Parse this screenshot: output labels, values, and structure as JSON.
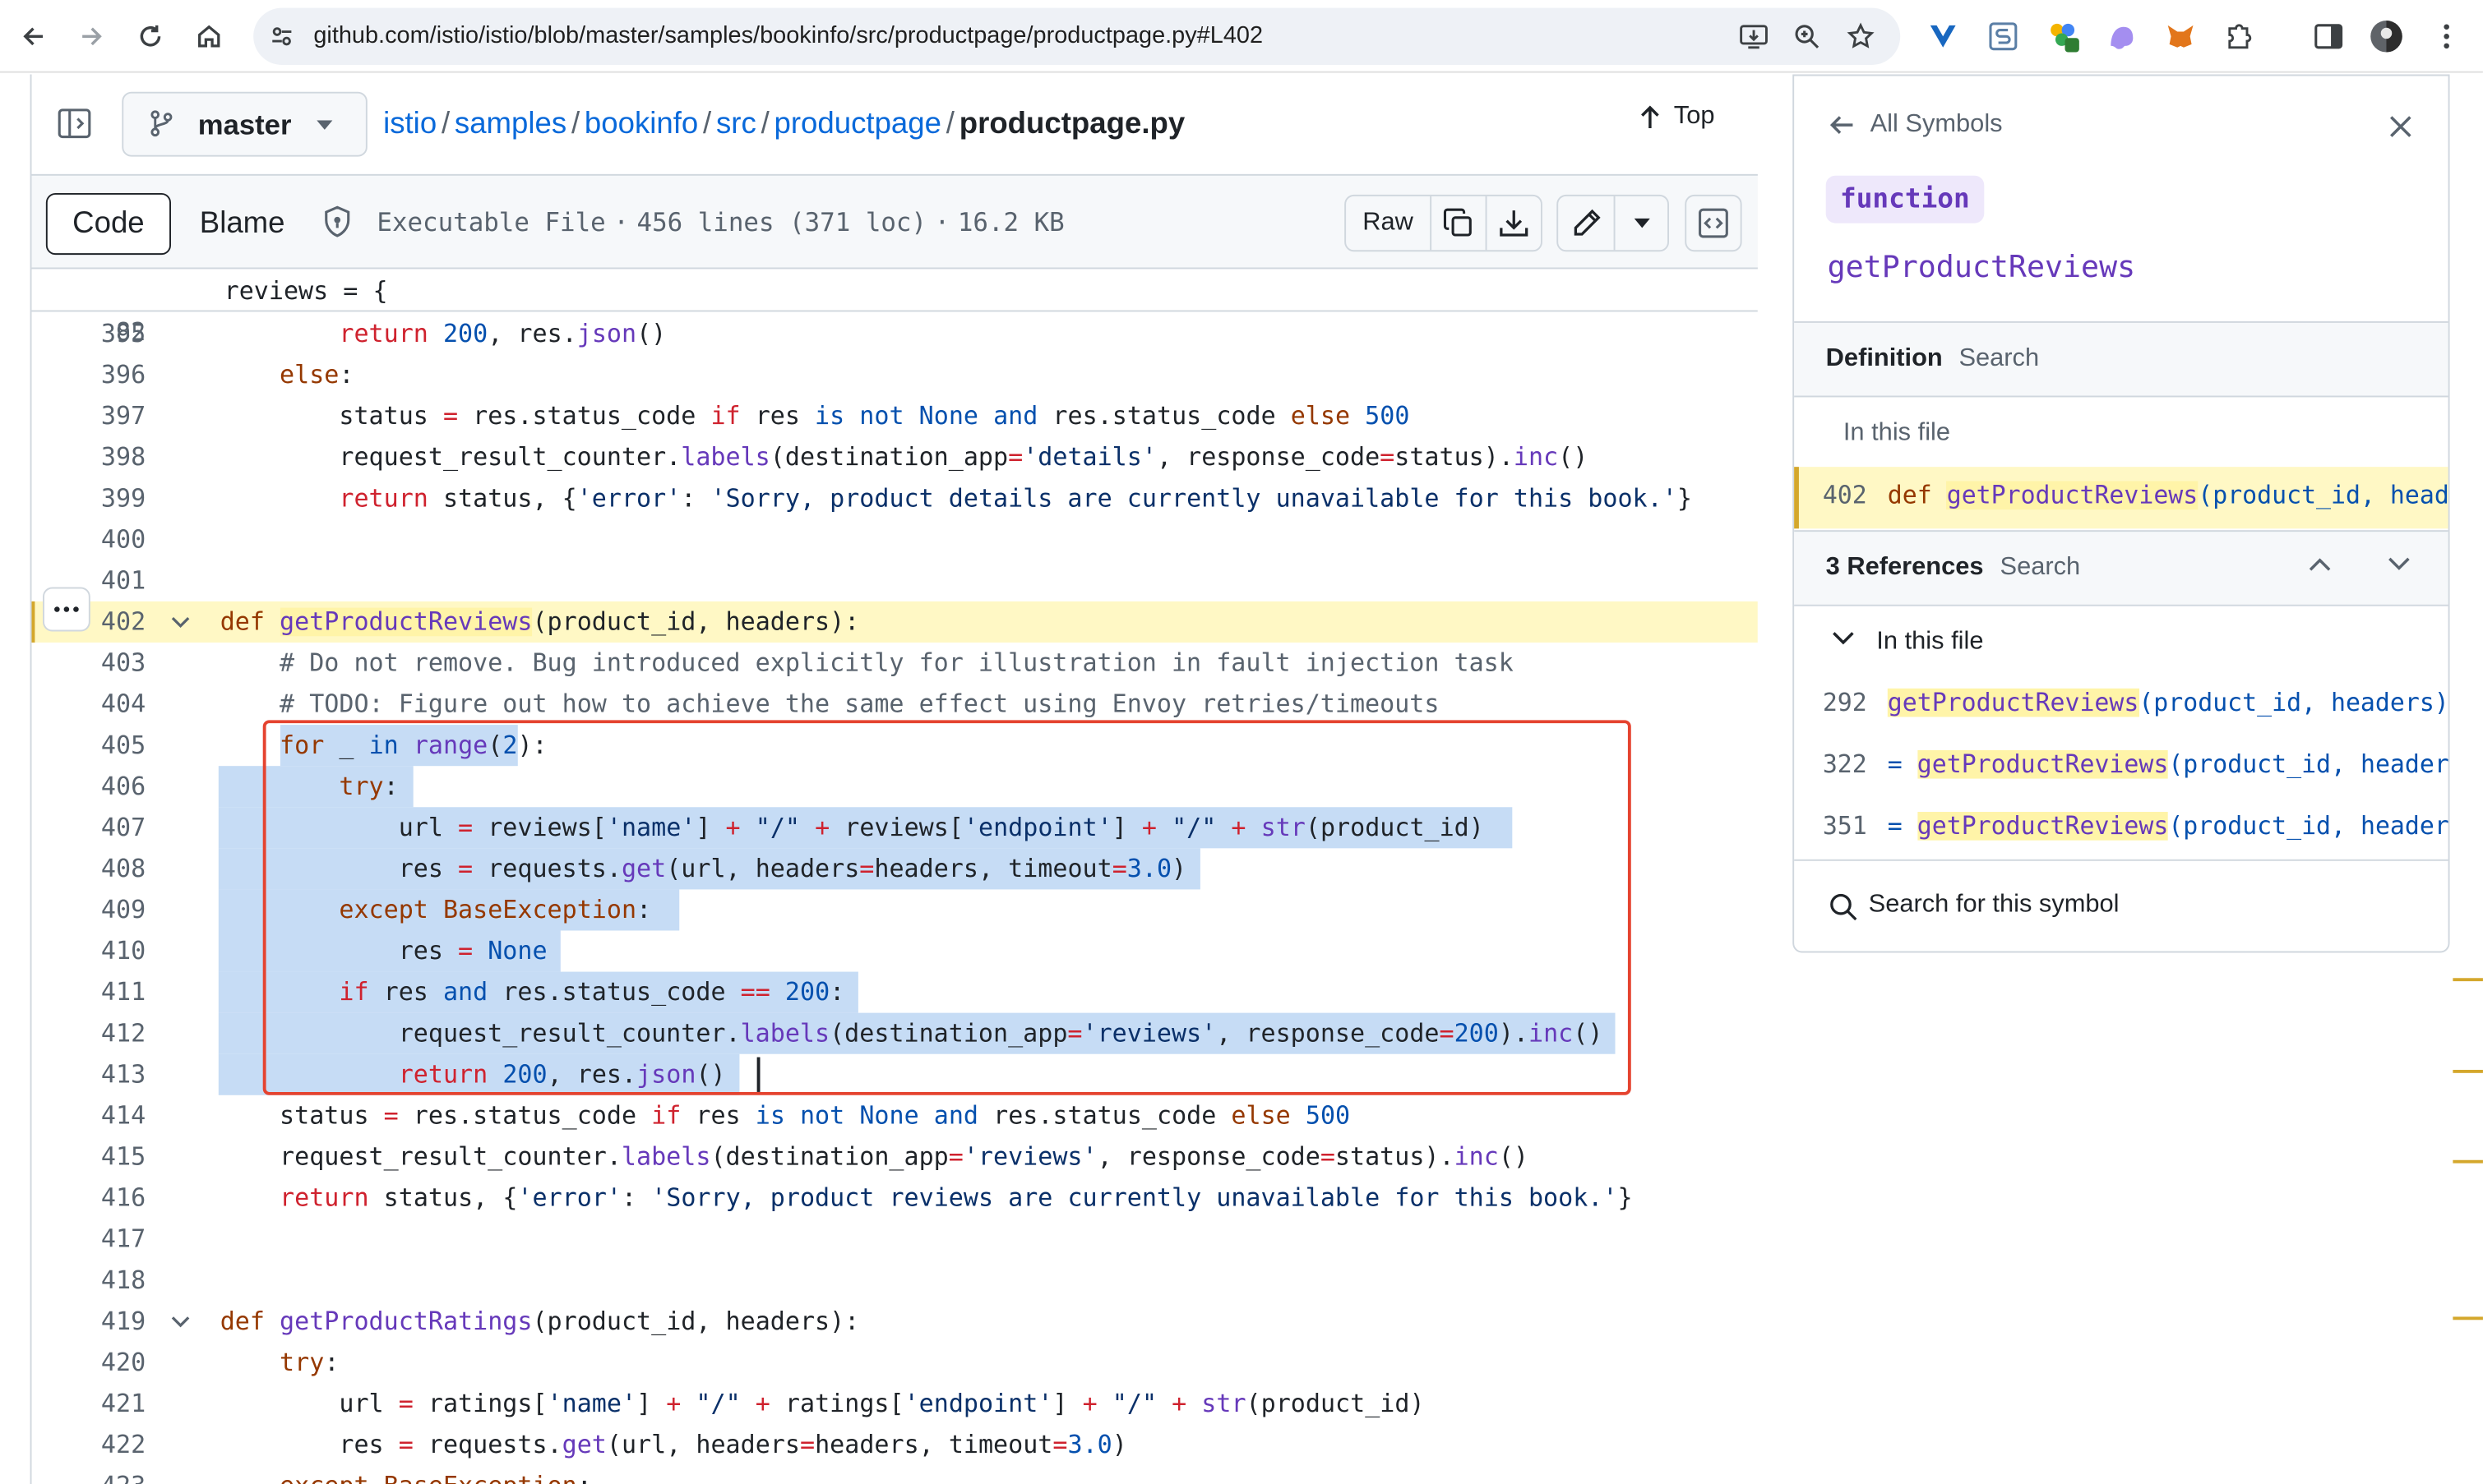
{
  "browser": {
    "url": "github.com/istio/istio/blob/master/samples/bookinfo/src/productpage/productpage.py#L402"
  },
  "file_header": {
    "branch": "master",
    "breadcrumbs": [
      "istio",
      "samples",
      "bookinfo",
      "src",
      "productpage"
    ],
    "separator": "/",
    "filename": "productpage.py",
    "top_label": "Top"
  },
  "toolbar": {
    "code_tab": "Code",
    "blame_tab": "Blame",
    "file_type": "Executable File",
    "dot": "·",
    "lines_info": "456 lines (371 loc)",
    "size": "16.2 KB",
    "raw_label": "Raw"
  },
  "code": {
    "sticky": {
      "n": "82",
      "text": "    reviews = {"
    },
    "lines": [
      {
        "n": "395",
        "html": "        <span class=\"kw\">return</span> <span class=\"num\">200</span>, res.<span class=\"fn\">json</span>()"
      },
      {
        "n": "396",
        "html": "    <span class=\"kw2\">else</span>:"
      },
      {
        "n": "397",
        "html": "        status <span class=\"kw\">=</span> res.status_code <span class=\"kw\">if</span> res <span class=\"num\">is not</span> <span class=\"num\">None</span> <span class=\"num\">and</span> res.status_code <span class=\"kw2\">else</span> <span class=\"num\">500</span>"
      },
      {
        "n": "398",
        "html": "        request_result_counter.<span class=\"fn\">labels</span>(destination_app<span class=\"kw\">=</span><span class=\"str\">'details'</span>, response_code<span class=\"kw\">=</span>status).<span class=\"fn\">inc</span>()"
      },
      {
        "n": "399",
        "html": "        <span class=\"kw\">return</span> status, {<span class=\"str\">'error'</span>: <span class=\"str\">'Sorry, product details are currently unavailable for this book.'</span>}"
      },
      {
        "n": "400",
        "html": ""
      },
      {
        "n": "401",
        "html": ""
      },
      {
        "n": "402",
        "html": "<span class=\"kw2\">def</span> <span class=\"fn mark\">getProductReviews</span>(product_id, headers):",
        "highlight": true,
        "fold": true
      },
      {
        "n": "403",
        "html": "    <span class=\"cm\"># Do not remove. Bug introduced explicitly for illustration in fault injection task</span>"
      },
      {
        "n": "404",
        "html": "    <span class=\"cm\"># TODO: Figure out how to achieve the same effect using Envoy retries/timeouts</span>"
      },
      {
        "n": "405",
        "html": "    <span class=\"kw2\">for</span> _ <span class=\"num\">in</span> <span class=\"fn\">range</span>(<span class=\"num\">2</span>):"
      },
      {
        "n": "406",
        "html": "        <span class=\"kw2\">try</span>:"
      },
      {
        "n": "407",
        "html": "            url <span class=\"kw\">=</span> reviews[<span class=\"str\">'name'</span>] <span class=\"kw\">+</span> <span class=\"str\">\"/\"</span> <span class=\"kw\">+</span> reviews[<span class=\"str\">'endpoint'</span>] <span class=\"kw\">+</span> <span class=\"str\">\"/\"</span> <span class=\"kw\">+</span> <span class=\"fn\">str</span>(product_id)"
      },
      {
        "n": "408",
        "html": "            res <span class=\"kw\">=</span> requests.<span class=\"fn\">get</span>(url, headers<span class=\"kw\">=</span>headers, timeout<span class=\"kw\">=</span><span class=\"num\">3.0</span>)"
      },
      {
        "n": "409",
        "html": "        <span class=\"kw2\">except</span> <span class=\"kw2\">BaseException</span>:"
      },
      {
        "n": "410",
        "html": "            res <span class=\"kw\">=</span> <span class=\"num\">None</span>"
      },
      {
        "n": "411",
        "html": "        <span class=\"kw\">if</span> res <span class=\"num\">and</span> res.status_code <span class=\"kw\">==</span> <span class=\"num\">200</span>:"
      },
      {
        "n": "412",
        "html": "            request_result_counter.<span class=\"fn\">labels</span>(destination_app<span class=\"kw\">=</span><span class=\"str\">'reviews'</span>, response_code<span class=\"kw\">=</span><span class=\"num\">200</span>).<span class=\"fn\">inc</span>()"
      },
      {
        "n": "413",
        "html": "            <span class=\"kw\">return</span> <span class=\"num\">200</span>, res.<span class=\"fn\">json</span>()"
      },
      {
        "n": "414",
        "html": "    status <span class=\"kw\">=</span> res.status_code <span class=\"kw\">if</span> res <span class=\"num\">is not</span> <span class=\"num\">None</span> <span class=\"num\">and</span> res.status_code <span class=\"kw2\">else</span> <span class=\"num\">500</span>"
      },
      {
        "n": "415",
        "html": "    request_result_counter.<span class=\"fn\">labels</span>(destination_app<span class=\"kw\">=</span><span class=\"str\">'reviews'</span>, response_code<span class=\"kw\">=</span>status).<span class=\"fn\">inc</span>()"
      },
      {
        "n": "416",
        "html": "    <span class=\"kw\">return</span> status, {<span class=\"str\">'error'</span>: <span class=\"str\">'Sorry, product reviews are currently unavailable for this book.'</span>}"
      },
      {
        "n": "417",
        "html": ""
      },
      {
        "n": "418",
        "html": ""
      },
      {
        "n": "419",
        "html": "<span class=\"kw2\">def</span> <span class=\"fn\">getProductRatings</span>(product_id, headers):",
        "fold": true
      },
      {
        "n": "420",
        "html": "    <span class=\"kw2\">try</span>:"
      },
      {
        "n": "421",
        "html": "        url <span class=\"kw\">=</span> ratings[<span class=\"str\">'name'</span>] <span class=\"kw\">+</span> <span class=\"str\">\"/\"</span> <span class=\"kw\">+</span> ratings[<span class=\"str\">'endpoint'</span>] <span class=\"kw\">+</span> <span class=\"str\">\"/\"</span> <span class=\"kw\">+</span> <span class=\"fn\">str</span>(product_id)"
      },
      {
        "n": "422",
        "html": "        res <span class=\"kw\">=</span> requests.<span class=\"fn\">get</span>(url, headers<span class=\"kw\">=</span>headers, timeout<span class=\"kw\">=</span><span class=\"num\">3.0</span>)"
      },
      {
        "n": "423",
        "html": "    <span class=\"kw2\">except</span> <span class=\"kw2\">BaseException</span>:"
      }
    ]
  },
  "symbols": {
    "back_label": "All Symbols",
    "kind": "function",
    "name": "getProductReviews",
    "definition_tab": "Definition",
    "search_tab": "Search",
    "in_this_file": "In this file",
    "definition_row": {
      "n": "402",
      "html": "<span class=\"kw2\">def</span> <span class=\"fn mark\">getProductReviews</span><span class=\"num\">(product_id, headers):</span>"
    },
    "references_title": "3 References",
    "references_search": "Search",
    "references_in_file": "In this file",
    "references": [
      {
        "n": "292",
        "html": "<span class=\"fn mark\">getProductReviews</span><span class=\"num\">(product_id, headers)</span>"
      },
      {
        "n": "322",
        "html": "<span class=\"num\">=</span> <span class=\"fn mark\">getProductReviews</span><span class=\"num\">(product_id, headers)</span>"
      },
      {
        "n": "351",
        "html": "<span class=\"num\">=</span> <span class=\"fn mark\">getProductReviews</span><span class=\"num\">(product_id, headers)</span>"
      }
    ],
    "search_symbol_label": "Search for this symbol"
  },
  "colors": {
    "link": "#0969da",
    "highlight_row": "#fff8c5",
    "selection": "#c6dcf5",
    "annotation_box": "#e5432f"
  }
}
